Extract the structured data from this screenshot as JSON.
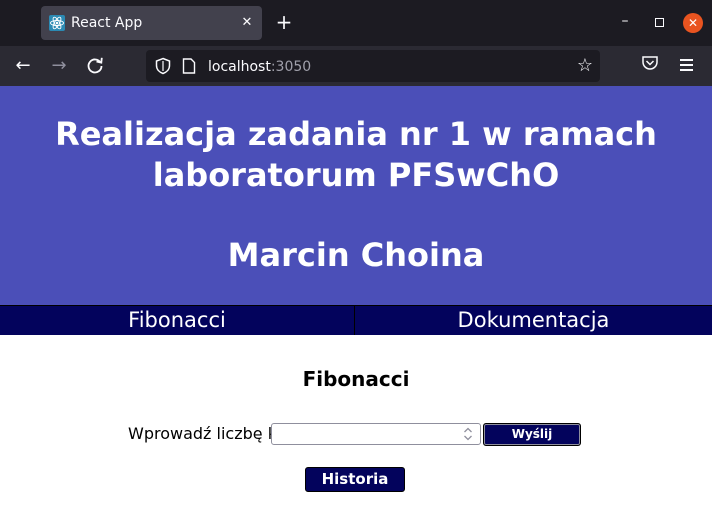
{
  "browser": {
    "tab_title": "React App",
    "url_host": "localhost",
    "url_port": ":3050",
    "icons": {
      "favicon": "react-logo-icon",
      "tab_close": "close-icon",
      "new_tab": "plus-icon",
      "back": "arrow-left-icon",
      "forward": "arrow-right-icon",
      "reload": "reload-icon",
      "shield": "shield-icon",
      "page": "page-icon",
      "bookmark": "star-icon",
      "pocket": "pocket-icon",
      "menu": "hamburger-menu-icon",
      "minimize": "minimize-icon",
      "maximize": "maximize-icon",
      "close": "window-close-icon"
    },
    "colors": {
      "window_close": "#e95420",
      "tabbar": "#1c1b22",
      "toolbar": "#2b2a33"
    }
  },
  "page": {
    "header": {
      "title": "Realizacja zadania nr 1 w ramach laboratorum PFSwChO",
      "author": "Marcin Choina"
    },
    "menu": {
      "items": [
        {
          "label": "Fibonacci"
        },
        {
          "label": "Dokumentacja"
        }
      ]
    },
    "section_title": "Fibonacci",
    "form": {
      "label": "Wprowadź liczbę k:",
      "input_value": "",
      "submit_label": "Wyślij"
    },
    "history_label": "Historia",
    "colors": {
      "header_bg": "#4b4fb8",
      "menu_bg": "#03035c",
      "button_bg": "#03035c"
    }
  }
}
